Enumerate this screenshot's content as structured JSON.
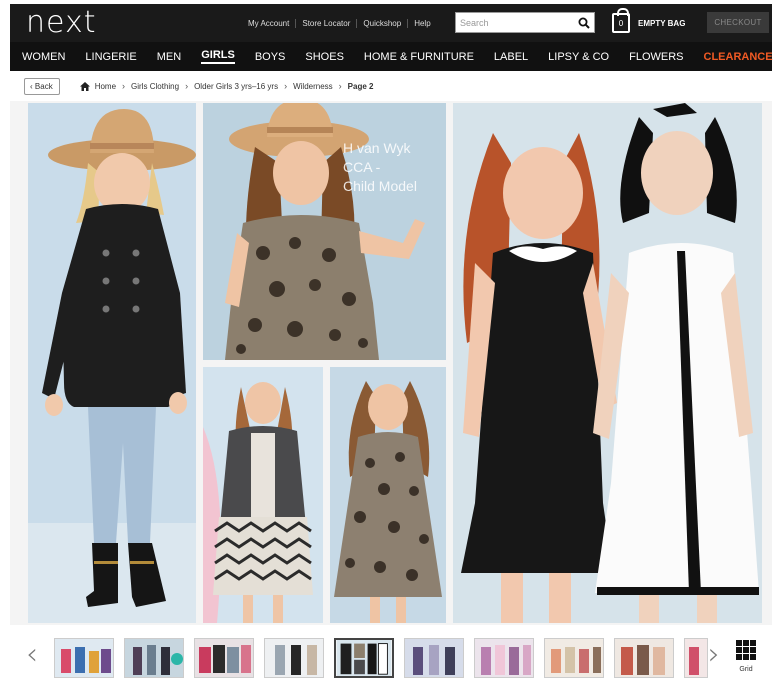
{
  "header": {
    "logo": "next",
    "utility_links": [
      "My Account",
      "Store Locator",
      "Quickshop",
      "Help"
    ],
    "search_placeholder": "Search",
    "bag_count": "0",
    "bag_label": "EMPTY BAG",
    "checkout_label": "CHECKOUT"
  },
  "nav": {
    "items": [
      "WOMEN",
      "LINGERIE",
      "MEN",
      "GIRLS",
      "BOYS",
      "SHOES",
      "HOME & FURNITURE",
      "LABEL",
      "LIPSY & CO",
      "FLOWERS",
      "CLEARANCE"
    ],
    "active": "GIRLS",
    "sale": "CLEARANCE"
  },
  "breadcrumb": {
    "back_label": "Back",
    "items": [
      "Home",
      "Girls Clothing",
      "Older Girls 3 yrs–16 yrs",
      "Wilderness",
      "Page 2"
    ]
  },
  "hero": {
    "watermark": [
      "H van Wyk",
      "CCA -",
      "Child Model"
    ]
  },
  "strip": {
    "grid_label": "Grid",
    "thumb_count": 10,
    "selected_index": 4
  },
  "colors": {
    "header_bg": "#1a1a1a",
    "nav_bg": "#111111",
    "clearance": "#f15a24"
  }
}
